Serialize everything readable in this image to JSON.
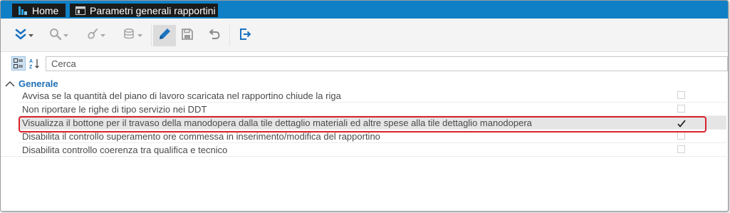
{
  "tabs": [
    {
      "label": "Home",
      "icon": "home-app-icon"
    },
    {
      "label": "Parametri generali rapportini",
      "icon": "form-window-icon"
    }
  ],
  "toolbar": {
    "buttons": [
      {
        "name": "expand-menu-button",
        "icon": "double-chevron-down-icon",
        "has_dropdown": true
      },
      {
        "name": "search-button",
        "icon": "magnifier-icon",
        "has_dropdown": true
      },
      {
        "name": "clean-button",
        "icon": "brush-icon",
        "has_dropdown": true
      },
      {
        "name": "database-button",
        "icon": "database-icon",
        "has_dropdown": true
      },
      {
        "name": "edit-button",
        "icon": "pencil-icon",
        "has_dropdown": false,
        "active": true
      },
      {
        "name": "save-button",
        "icon": "floppy-disk-icon",
        "has_dropdown": false
      },
      {
        "name": "undo-button",
        "icon": "undo-arrow-icon",
        "has_dropdown": false
      },
      {
        "name": "exit-button",
        "icon": "exit-door-icon",
        "has_dropdown": false
      }
    ]
  },
  "search": {
    "placeholder": "Cerca",
    "value": ""
  },
  "group": {
    "title": "Generale",
    "expanded": true
  },
  "rows": [
    {
      "label": "Avvisa se la quantità del piano di lavoro scaricata nel rapportino chiude la riga",
      "checked": false,
      "selected": false
    },
    {
      "label": "Non riportare le righe di tipo servizio nei DDT",
      "checked": false,
      "selected": false
    },
    {
      "label": "Visualizza il bottone per il travaso della manodopera dalla tile dettaglio materiali ed altre spese alla tile dettaglio manodopera",
      "checked": true,
      "selected": true
    },
    {
      "label": "Disabilita il controllo superamento ore commessa in inserimento/modifica del rapportino",
      "checked": false,
      "selected": false
    },
    {
      "label": "Disabilita controllo coerenza tra qualifica e tecnico",
      "checked": false,
      "selected": false
    }
  ],
  "colors": {
    "accent": "#1080c6",
    "highlight": "#d9222a",
    "group_title": "#1f6fb5",
    "tab_bg": "#1b1b1b"
  }
}
